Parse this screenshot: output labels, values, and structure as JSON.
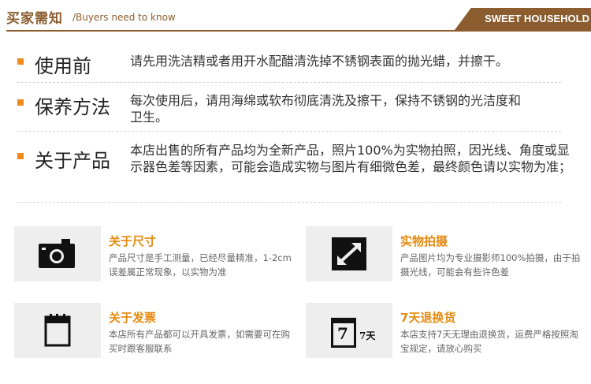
{
  "header": {
    "title": "买家需知",
    "subtitle": "/Buyers need to know",
    "brand": "SWEET HOUSEHOLD"
  },
  "notices": [
    {
      "title": "使用前",
      "text": "请先用洗洁精或者用开水配醋清洗掉不锈钢表面的抛光蜡，并擦干。"
    },
    {
      "title": "保养方法",
      "text": "每次使用后，请用海绵或软布彻底清洗及擦干，保持不锈钢的光洁度和卫生。"
    },
    {
      "title": "关于产品",
      "text": "本店出售的所有产品均为全新产品，照片100%为实物拍照，因光线、角度或显示器色差等因素，可能会造成实物与图片有细微色差，最终颜色请以实物为准；"
    }
  ],
  "cards": [
    {
      "icon": "camera-icon",
      "title": "关于尺寸",
      "text": "产品尺寸是手工测量，已经尽量精准，1-2cm误差属正常现象，以实物为准"
    },
    {
      "icon": "expand-arrows-icon",
      "title": "实物拍摄",
      "text": "产品图片均为专业摄影师100%拍摄，由于拍摄光线，可能会有些许色差"
    },
    {
      "icon": "invoice-icon",
      "title": "关于发票",
      "text": "本店所有产品都可以开具发票，如需要可在购买时跟客服联系"
    },
    {
      "icon": "seven-day-icon",
      "icon_text": "7",
      "icon_small_text": "7天",
      "title": "7天退换货",
      "text": "本店支持7天无理由退换货，运费严格按照淘宝规定，请放心购买"
    }
  ],
  "colors": {
    "brown": "#8a5c2e",
    "orange": "#e58b12",
    "bullet": "#f08a1c"
  }
}
